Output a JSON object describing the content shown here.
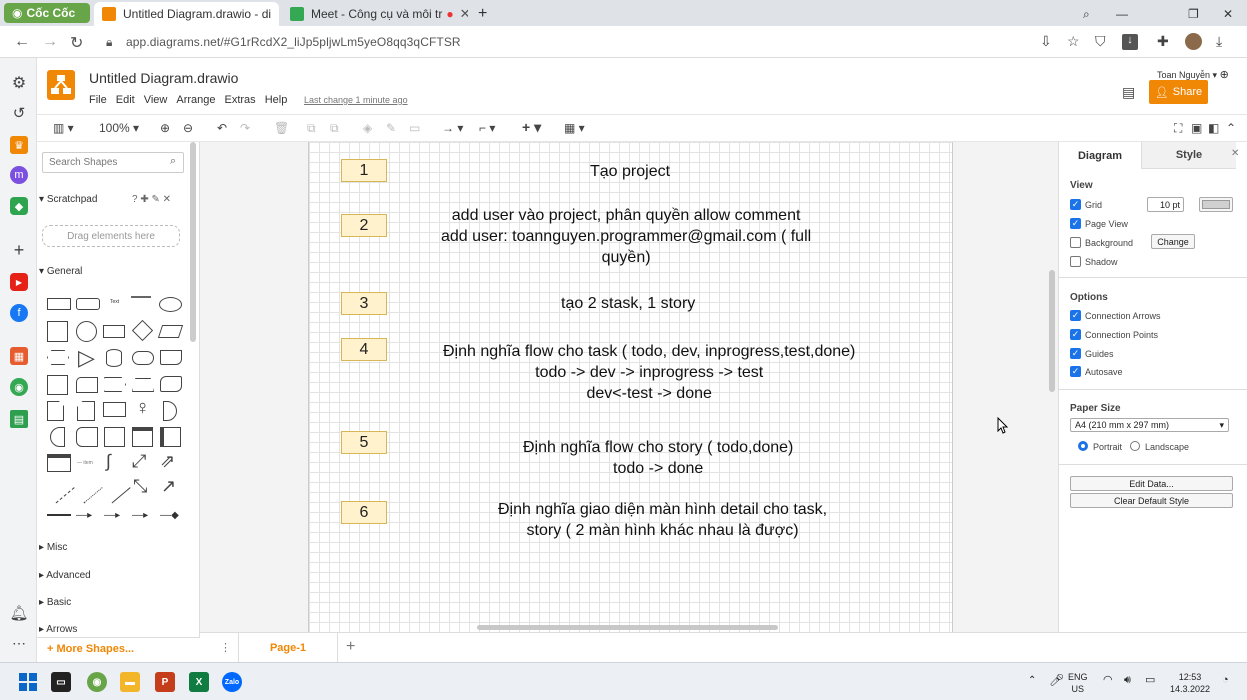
{
  "browser": {
    "brand": "Cốc Cốc",
    "tabs": [
      {
        "title": "Untitled Diagram.drawio - di"
      },
      {
        "title": "Meet - Công cụ và môi tr"
      }
    ],
    "url": "app.diagrams.net/#G1rRcdX2_liJp5pljwLm5yeO8qq3qCFTSR"
  },
  "app": {
    "title": "Untitled Diagram.drawio",
    "menu": [
      "File",
      "Edit",
      "View",
      "Arrange",
      "Extras",
      "Help"
    ],
    "last_change": "Last change 1 minute ago",
    "user": "Toan Nguyễn",
    "share": "Share",
    "zoom": "100%"
  },
  "shapes_panel": {
    "search_placeholder": "Search Shapes",
    "scratchpad": "Scratchpad",
    "drag_hint": "Drag elements here",
    "general": "General",
    "sections": [
      "Misc",
      "Advanced",
      "Basic",
      "Arrows"
    ],
    "more_shapes": "More Shapes..."
  },
  "diagram": {
    "rows": [
      {
        "num": "1",
        "text": "Tạo project"
      },
      {
        "num": "2",
        "text": "add user vào project, phân quyền allow comment\nadd user: toannguyen.programmer@gmail.com ( full\nquyền)"
      },
      {
        "num": "3",
        "text": "tạo 2 stask, 1 story"
      },
      {
        "num": "4",
        "text": "Định nghĩa flow cho task ( todo, dev, inprogress,test,done)\ntodo -> dev -> inprogress -> test\ndev<-test -> done"
      },
      {
        "num": "5",
        "text": "Định nghĩa flow cho story ( todo,done)\ntodo -> done"
      },
      {
        "num": "6",
        "text": "Định nghĩa giao diện màn hình detail cho task,\nstory ( 2 màn hình khác nhau là được)"
      }
    ]
  },
  "format_panel": {
    "tabs": [
      "Diagram",
      "Style"
    ],
    "view_label": "View",
    "grid": "Grid",
    "grid_size": "10 pt",
    "page_view": "Page View",
    "background": "Background",
    "change": "Change",
    "shadow": "Shadow",
    "options_label": "Options",
    "connection_arrows": "Connection Arrows",
    "connection_points": "Connection Points",
    "guides": "Guides",
    "autosave": "Autosave",
    "paper_size_label": "Paper Size",
    "paper_size": "A4 (210 mm x 297 mm)",
    "portrait": "Portrait",
    "landscape": "Landscape",
    "edit_data": "Edit Data...",
    "clear_default_style": "Clear Default Style"
  },
  "pages": {
    "tab": "Page-1"
  },
  "taskbar": {
    "lang": "ENG",
    "region": "US",
    "time": "12:53",
    "date": "14.3.2022",
    "zalo": "Zalo"
  },
  "colors": {
    "accent": "#f08705",
    "check": "#1a73e8",
    "note_fill": "#fff2cc",
    "note_border": "#d6b656"
  }
}
